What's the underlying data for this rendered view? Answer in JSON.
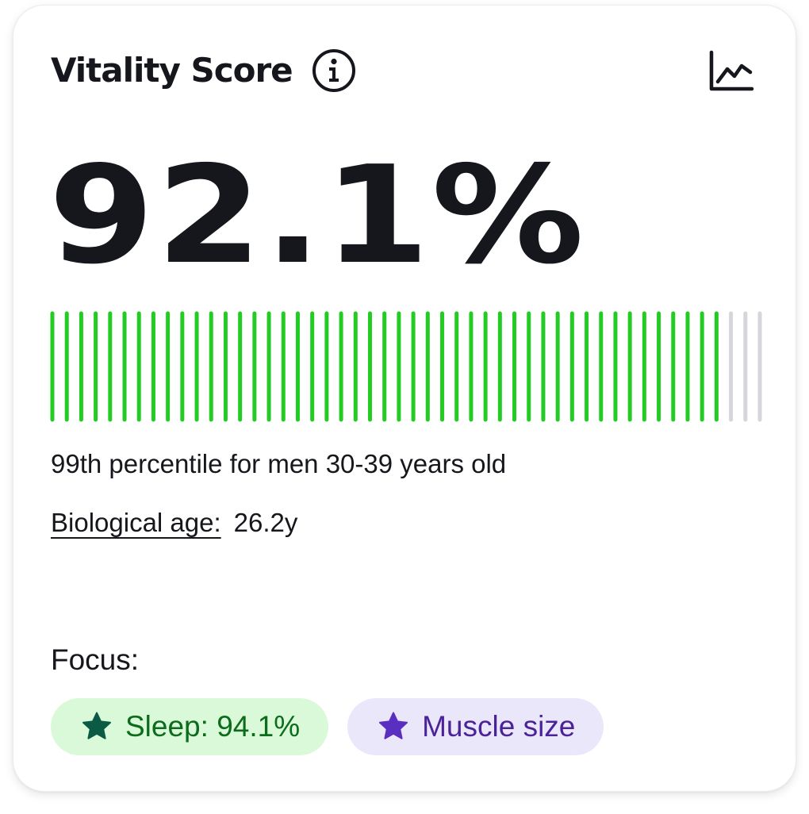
{
  "card": {
    "title": "Vitality Score",
    "score": "92.1%",
    "progress_fraction": 0.935,
    "bar_segments": 50,
    "bar_colors": {
      "filled": "#22cc22",
      "empty": "#d4d6dc"
    },
    "percentile_text": "99th percentile for men 30-39 years old",
    "bio_age_label": "Biological age:",
    "bio_age_value": "26.2y",
    "focus_label": "Focus:",
    "chips": [
      {
        "label": "Sleep: 94.1%",
        "icon": "star-icon",
        "bg": "#d9f9d9",
        "fg": "#0d6b1c",
        "icon_color": "#0b5b44"
      },
      {
        "label": "Muscle size",
        "icon": "star-icon",
        "bg": "#ebe7fb",
        "fg": "#4b2399",
        "icon_color": "#5a2ec0"
      }
    ]
  },
  "icons": {
    "info": "info-circle-icon",
    "chart": "line-chart-icon"
  }
}
